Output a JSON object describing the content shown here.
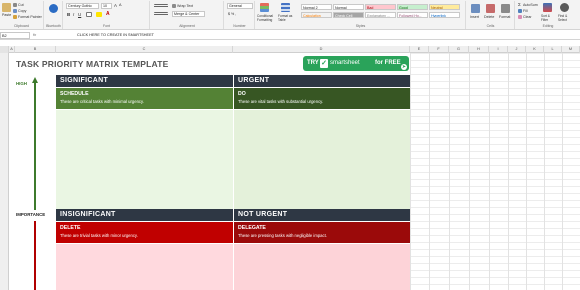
{
  "ribbon": {
    "clipboard": {
      "paste": "Paste",
      "cut": "Cut",
      "copy": "Copy",
      "format_painter": "Format Painter",
      "label": "Clipboard"
    },
    "bluetooth": {
      "label": "Bluetooth"
    },
    "font": {
      "family": "Century Gothic",
      "size": "10",
      "label": "Font"
    },
    "alignment": {
      "wrap_text": "Wrap Text",
      "merge_center": "Merge & Center",
      "label": "Alignment"
    },
    "number": {
      "format": "General",
      "label": "Number"
    },
    "styles": {
      "conditional_formatting": "Conditional Formatting",
      "format_as_table": "Format as Table",
      "cells": [
        {
          "name": "Normal 2",
          "bg": "#ffffff",
          "fg": "#222222"
        },
        {
          "name": "Normal",
          "bg": "#ffffff",
          "fg": "#222222"
        },
        {
          "name": "Bad",
          "bg": "#ffc7ce",
          "fg": "#9c0006"
        },
        {
          "name": "Good",
          "bg": "#c6efce",
          "fg": "#006100"
        },
        {
          "name": "Neutral",
          "bg": "#ffeb9c",
          "fg": "#9c5700"
        },
        {
          "name": "Calculation",
          "bg": "#f2f2f2",
          "fg": "#fa7d00"
        },
        {
          "name": "Check Cell",
          "bg": "#a5a5a5",
          "fg": "#ffffff"
        },
        {
          "name": "Explanatory ...",
          "bg": "#ffffff",
          "fg": "#7f7f7f"
        },
        {
          "name": "Followed Hy...",
          "bg": "#ffffff",
          "fg": "#954f72"
        },
        {
          "name": "Hyperlink",
          "bg": "#ffffff",
          "fg": "#0563c1"
        }
      ],
      "label": "Styles"
    },
    "cells": {
      "insert": "Insert",
      "delete": "Delete",
      "format": "Format",
      "label": "Cells"
    },
    "editing": {
      "autosum": "AutoSum",
      "fill": "Fill",
      "clear": "Clear",
      "sort_filter": "Sort & Filter",
      "find_select": "Find & Select",
      "label": "Editing"
    }
  },
  "formula_bar": {
    "name_box": "B2",
    "fx": "fx",
    "formula": "CLICK HERE TO CREATE IN SMARTSHEET"
  },
  "columns": [
    "A",
    "B",
    "C",
    "D",
    "E",
    "F",
    "G",
    "H",
    "I",
    "J",
    "K",
    "L",
    "M"
  ],
  "sheet": {
    "title": "TASK PRIORITY MATRIX TEMPLATE",
    "cta": {
      "try": "TRY",
      "brand": "smartsheet",
      "free": "for FREE"
    },
    "axis": {
      "high": "HIGH",
      "importance": "IMPORTANCE"
    },
    "headers": {
      "significant": "SIGNIFICANT",
      "urgent": "URGENT",
      "insignificant": "INSIGNIFICANT",
      "not_urgent": "NOT URGENT"
    },
    "quadrants": {
      "schedule": {
        "title": "SCHEDULE",
        "desc": "These are critical tasks with minimal urgency."
      },
      "do": {
        "title": "DO",
        "desc": "These are vital tasks with substantial urgency."
      },
      "delete": {
        "title": "DELETE",
        "desc": "These are trivial tasks with minor urgency."
      },
      "delegate": {
        "title": "DELEGATE",
        "desc": "These are pressing tasks with negligible impact."
      }
    }
  },
  "colors": {
    "header_dark": "#2e3744",
    "schedule": "#548235",
    "do": "#375623",
    "delete": "#c00000",
    "delegate": "#9b0a0a",
    "green_body": "#eaf6e3",
    "red_body": "#ffd9de",
    "cta": "#2aa35a"
  }
}
